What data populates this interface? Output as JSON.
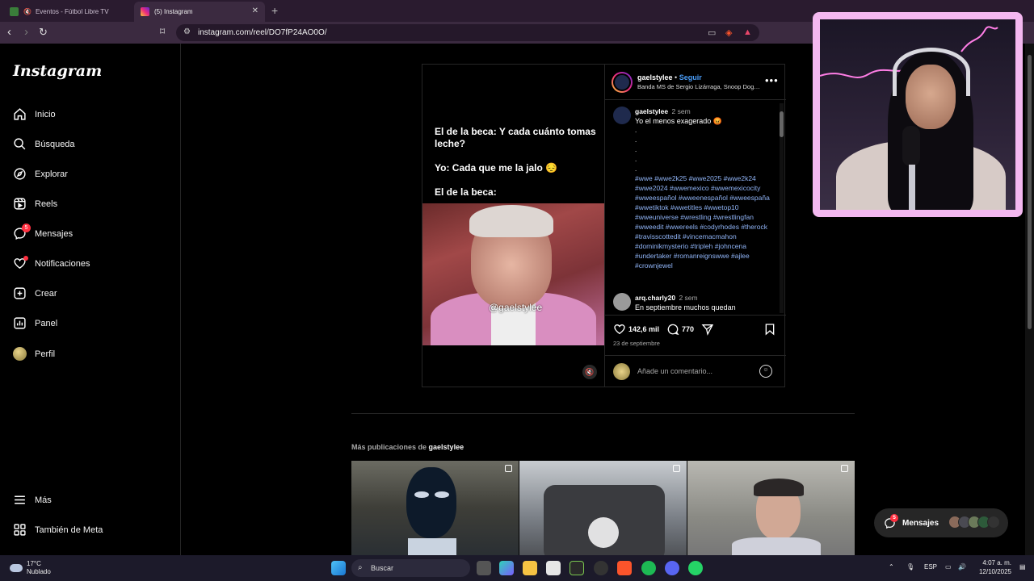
{
  "browser": {
    "tabs": [
      {
        "title": "Eventos - Fútbol Libre TV",
        "active": false
      },
      {
        "title": "(5) Instagram",
        "active": true
      }
    ],
    "url": "instagram.com/reel/DO7fP24AO0O/"
  },
  "sidebar": {
    "logo": "Instagram",
    "items": [
      {
        "label": "Inicio",
        "icon": "home-icon"
      },
      {
        "label": "Búsqueda",
        "icon": "search-icon"
      },
      {
        "label": "Explorar",
        "icon": "compass-icon"
      },
      {
        "label": "Reels",
        "icon": "reels-icon"
      },
      {
        "label": "Mensajes",
        "icon": "messenger-icon",
        "badge": "5"
      },
      {
        "label": "Notificaciones",
        "icon": "heart-icon"
      },
      {
        "label": "Crear",
        "icon": "plus-square-icon"
      },
      {
        "label": "Panel",
        "icon": "chart-icon"
      },
      {
        "label": "Perfil",
        "icon": "avatar"
      }
    ],
    "bottom": [
      {
        "label": "Más",
        "icon": "menu-icon"
      },
      {
        "label": "También de Meta",
        "icon": "grid-icon"
      }
    ]
  },
  "post": {
    "overlay_text": "El de la beca: Y cada cuánto tomas leche?\n\nYo: Cada que me la jalo 😔\n\nEl de la beca:",
    "watermark": "@gaelstylee",
    "author": "gaelstylee",
    "follow_label": "Seguir",
    "audio": "Banda MS de Sergio Lizárraga, Snoop Dogg · Che",
    "caption": {
      "author": "gaelstylee",
      "time": "2 sem",
      "text": "Yo el menos exagerado 😡",
      "hashtags": "#wwe #wwe2k25 #wwe2025 #wwe2k24 #wwe2024 #wwemexico #wwemexicocity #wweespañol #wweenespañol #wweespaña #wwetiktok #wwetitles #wwetop10 #wweuniverse #wrestling #wrestlingfan #wweedit #wwereels #codyrhodes #therock #travisscottedit #vincemacmahon #dominikmysterio #tripleh #johncena #undertaker #romanreignswwe #ajlee #crownjewel"
    },
    "comment": {
      "author": "arq.charly20",
      "time": "2 sem",
      "text": "En septiembre muchos quedan"
    },
    "likes": "142,6 mil",
    "comments_count": "770",
    "date": "23 de septiembre",
    "add_comment_placeholder": "Añade un comentario..."
  },
  "more_posts": {
    "prefix": "Más publicaciones de",
    "author": "gaelstylee"
  },
  "messages_pill": {
    "label": "Mensajes",
    "badge": "5"
  },
  "taskbar": {
    "temp": "17°C",
    "condition": "Nublado",
    "search_label": "Buscar",
    "lang": "ESP",
    "time": "4:07 a. m.",
    "date": "12/10/2025"
  },
  "colors": {
    "ig_blue": "#4a9df8",
    "badge_red": "#ff3040",
    "webcam_frame": "#f4b8f0"
  }
}
